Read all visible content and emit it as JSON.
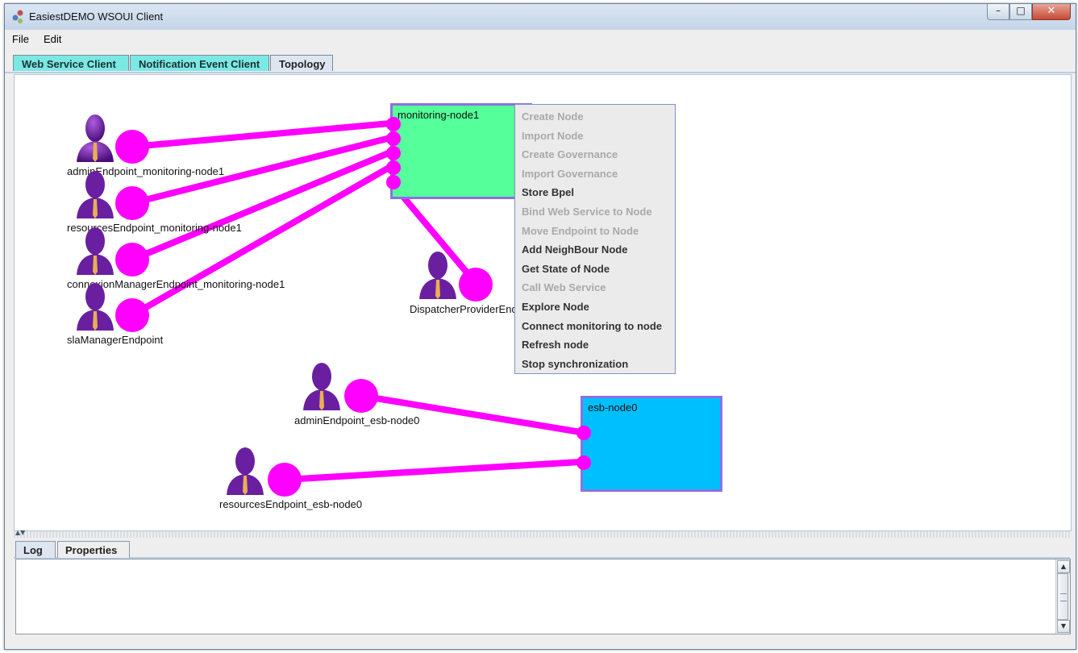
{
  "window": {
    "title": "EasiestDEMO WSOUI Client",
    "controls": {
      "minimize": "–",
      "maximize": "□",
      "close": "✕"
    }
  },
  "menubar": {
    "items": [
      "File",
      "Edit"
    ]
  },
  "tabs": [
    "Web Service Client",
    "Notification Event Client",
    "Topology"
  ],
  "active_tab": "Topology",
  "topology": {
    "nodes": [
      {
        "label": "monitoring-node1",
        "color": "#55ff99"
      },
      {
        "label": "esb-node0",
        "color": "#00bfff"
      }
    ],
    "endpoints": [
      "adminEndpoint_monitoring-node1",
      "resourcesEndpoint_monitoring-node1",
      "connexionManagerEndpoint_monitoring-node1",
      "slaManagerEndpoint",
      "DispatcherProviderEndpoint",
      "adminEndpoint_esb-node0",
      "resourcesEndpoint_esb-node0"
    ],
    "link_color": "#ff00ff",
    "endpoint_icon": "person-icon"
  },
  "context_menu": {
    "items": [
      {
        "label": "Create Node",
        "enabled": false
      },
      {
        "label": "Import Node",
        "enabled": false
      },
      {
        "label": "Create Governance",
        "enabled": false
      },
      {
        "label": "Import Governance",
        "enabled": false
      },
      {
        "label": "Store Bpel",
        "enabled": true
      },
      {
        "label": "Bind Web Service to Node",
        "enabled": false
      },
      {
        "label": "Move Endpoint to Node",
        "enabled": false
      },
      {
        "label": "Add NeighBour Node",
        "enabled": true
      },
      {
        "label": "Get State of Node",
        "enabled": true
      },
      {
        "label": "Call Web Service",
        "enabled": false
      },
      {
        "label": "Explore Node",
        "enabled": true
      },
      {
        "label": "Connect monitoring to node",
        "enabled": true
      },
      {
        "label": "Refresh node",
        "enabled": true
      },
      {
        "label": "Stop synchronization",
        "enabled": true
      }
    ]
  },
  "bottom_panel": {
    "tabs": [
      "Log",
      "Properties"
    ],
    "active_tab": "Log",
    "log_text": ""
  }
}
